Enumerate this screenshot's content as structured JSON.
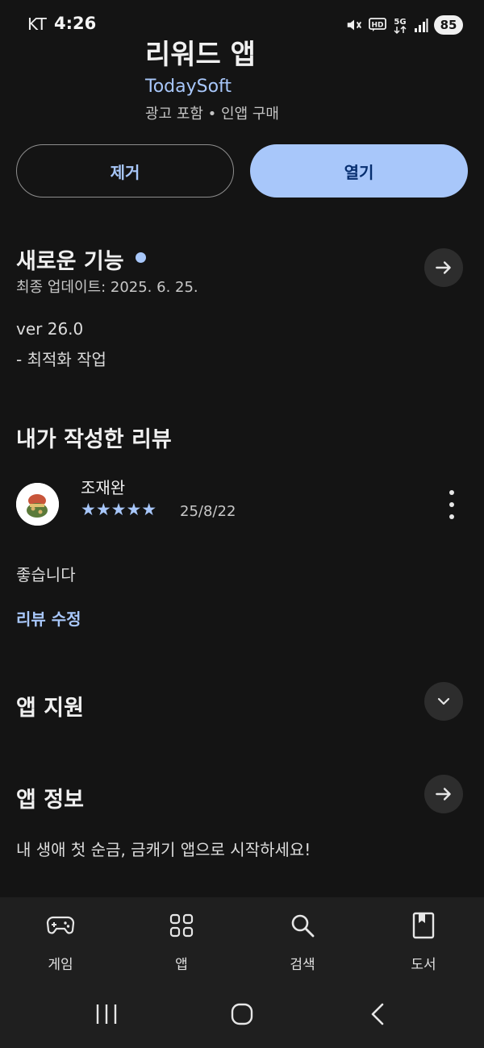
{
  "status_bar": {
    "carrier": "KT",
    "time": "4:26",
    "battery": "85",
    "icons": [
      "mute-icon",
      "hd-icon",
      "5g-icon",
      "signal-icon"
    ]
  },
  "app": {
    "title": "리워드 앱",
    "developer": "TodaySoft",
    "meta": "광고 포함 • 인앱 구매"
  },
  "actions": {
    "uninstall_label": "제거",
    "open_label": "열기"
  },
  "whats_new": {
    "title": "새로운 기능",
    "updated": "최종 업데이트: 2025. 6. 25.",
    "version": "ver 26.0",
    "notes": "- 최적화 작업"
  },
  "my_review": {
    "title": "내가 작성한 리뷰",
    "reviewer": "조재완",
    "rating": 5,
    "stars": "★★★★★",
    "date": "25/8/22",
    "text": "좋습니다",
    "edit_label": "리뷰 수정"
  },
  "app_support": {
    "title": "앱 지원"
  },
  "app_info": {
    "title": "앱 정보",
    "description": "내 생애 첫 순금, 금캐기 앱으로 시작하세요!"
  },
  "bottom_nav": {
    "items": [
      {
        "label": "게임",
        "icon": "gamepad-icon"
      },
      {
        "label": "앱",
        "icon": "apps-grid-icon"
      },
      {
        "label": "검색",
        "icon": "search-icon"
      },
      {
        "label": "도서",
        "icon": "book-icon"
      }
    ]
  },
  "colors": {
    "background": "#141414",
    "accent": "#a8c7fa",
    "nav_background": "#1f1f1f"
  }
}
